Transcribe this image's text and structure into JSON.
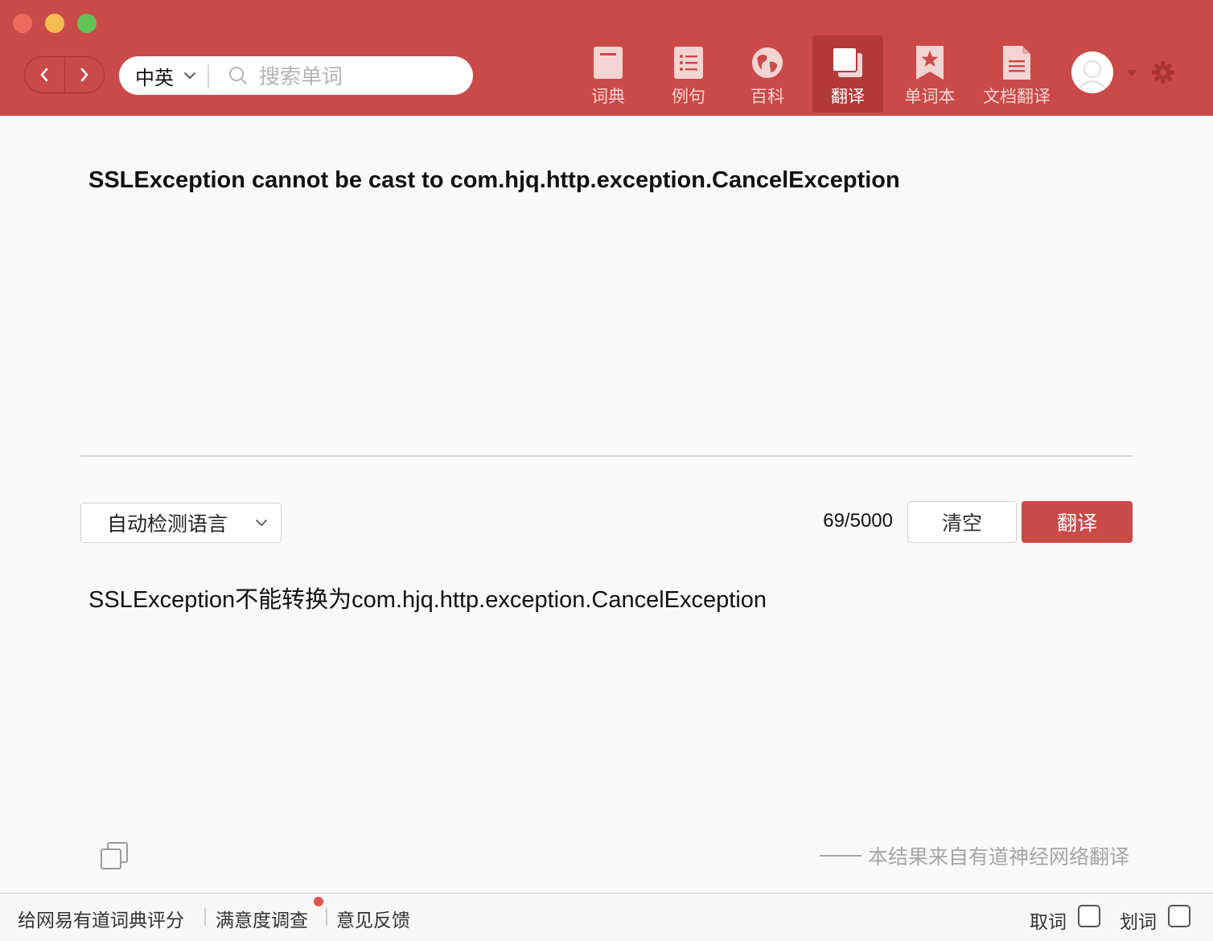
{
  "colors": {
    "accent": "#c94a48",
    "accent_dark": "#b33937"
  },
  "toolbar": {
    "lang_selector": "中英",
    "search_placeholder": "搜索单词",
    "tabs": [
      {
        "label": "词典",
        "icon": "dictionary-icon",
        "active": false
      },
      {
        "label": "例句",
        "icon": "list-icon",
        "active": false
      },
      {
        "label": "百科",
        "icon": "globe-icon",
        "active": false
      },
      {
        "label": "翻译",
        "icon": "translate-icon",
        "active": true
      },
      {
        "label": "单词本",
        "icon": "bookmark-star-icon",
        "active": false
      },
      {
        "label": "文档翻译",
        "icon": "document-icon",
        "active": false
      }
    ]
  },
  "translator": {
    "source_text": "SSLException cannot be cast to com.hjq.http.exception.CancelException",
    "source_language": "自动检测语言",
    "char_count": "69/5000",
    "clear_label": "清空",
    "translate_label": "翻译",
    "result_text": "SSLException不能转换为com.hjq.http.exception.CancelException",
    "credit": "本结果来自有道神经网络翻译"
  },
  "footer": {
    "rate_link": "给网易有道词典评分",
    "survey_link": "满意度调查",
    "feedback_link": "意见反馈",
    "pick_word_label": "取词",
    "select_word_label": "划词"
  }
}
